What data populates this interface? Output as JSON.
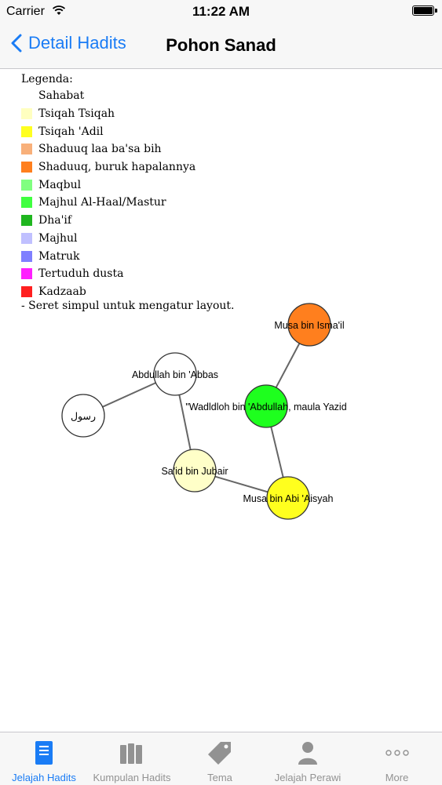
{
  "status_bar": {
    "carrier": "Carrier",
    "time": "11:22 AM"
  },
  "nav": {
    "back_label": "Detail Hadits",
    "title": "Pohon Sanad"
  },
  "legend": {
    "title": "Legenda:",
    "items": [
      {
        "label": "Sahabat",
        "color": "#ffffff"
      },
      {
        "label": "Tsiqah Tsiqah",
        "color": "#ffffc0"
      },
      {
        "label": "Tsiqah 'Adil",
        "color": "#ffff20"
      },
      {
        "label": "Shaduuq laa ba'sa bih",
        "color": "#f8b07a"
      },
      {
        "label": "Shaduuq, buruk hapalannya",
        "color": "#ff7f1e"
      },
      {
        "label": "Maqbul",
        "color": "#80ff80"
      },
      {
        "label": "Majhul Al-Haal/Mastur",
        "color": "#40ff40"
      },
      {
        "label": "Dha'if",
        "color": "#1fb61f"
      },
      {
        "label": "Majhul",
        "color": "#c0c0ff"
      },
      {
        "label": "Matruk",
        "color": "#7f7fff"
      },
      {
        "label": "Tertuduh dusta",
        "color": "#ff20ff"
      },
      {
        "label": "Kadzaab",
        "color": "#ff1f1f"
      }
    ],
    "hint": "- Seret simpul untuk mengatur layout."
  },
  "graph": {
    "nodes": [
      {
        "id": "rasul",
        "label": "رسول",
        "color": "#ffffff"
      },
      {
        "id": "abdullah",
        "label": "Abdullah bin 'Abbas",
        "color": "#ffffff"
      },
      {
        "id": "said",
        "label": "Sa'id bin Jubair",
        "color": "#ffffc8"
      },
      {
        "id": "musa_abi",
        "label": "Musa bin Abi 'Aisyah",
        "color": "#ffff1e"
      },
      {
        "id": "wadldloh",
        "label": "\"Wadldloh bin 'Abdullah, maula Yazid",
        "color": "#1eff1e"
      },
      {
        "id": "musa_isma",
        "label": "Musa bin Isma'il",
        "color": "#ff7f1e"
      }
    ],
    "edges": [
      [
        "rasul",
        "abdullah"
      ],
      [
        "abdullah",
        "said"
      ],
      [
        "said",
        "musa_abi"
      ],
      [
        "musa_abi",
        "wadldloh"
      ],
      [
        "wadldloh",
        "musa_isma"
      ]
    ]
  },
  "tabs": [
    {
      "label": "Jelajah Hadits",
      "icon": "book-icon",
      "active": true
    },
    {
      "label": "Kumpulan Hadits",
      "icon": "books-icon",
      "active": false
    },
    {
      "label": "Tema",
      "icon": "tag-icon",
      "active": false
    },
    {
      "label": "Jelajah Perawi",
      "icon": "person-icon",
      "active": false
    },
    {
      "label": "More",
      "icon": "more-icon",
      "active": false
    }
  ]
}
